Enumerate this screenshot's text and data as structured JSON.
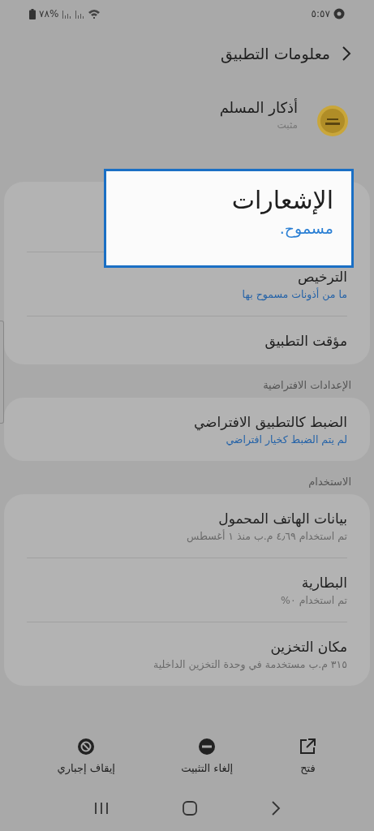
{
  "status_bar": {
    "time": "٥:٥٧",
    "battery": "%٧٨"
  },
  "header": {
    "title": "معلومات التطبيق"
  },
  "app": {
    "name": "أذكار المسلم",
    "status": "مثبت"
  },
  "highlight": {
    "title": "الإشعارات",
    "value": "مسموح."
  },
  "groups": [
    {
      "items": [
        {
          "title": "الترخيص",
          "subtitle": "ما من أذونات مسموح بها",
          "kind": "status"
        },
        {
          "title": "مؤقت التطبيق"
        }
      ]
    },
    {
      "label": "الإعدادات الافتراضية",
      "items": [
        {
          "title": "الضبط كالتطبيق الافتراضي",
          "subtitle": "لم يتم الضبط كخيار افتراضي",
          "kind": "status"
        }
      ]
    },
    {
      "label": "الاستخدام",
      "items": [
        {
          "title": "بيانات الهاتف المحمول",
          "subtitle": "تم استخدام ٤٫٦٩ م.ب منذ ١ أغسطس",
          "kind": "detail"
        },
        {
          "title": "البطارية",
          "subtitle": "تم استخدام ٠%",
          "kind": "detail"
        },
        {
          "title": "مكان التخزين",
          "subtitle": "٣١٥ م.ب مستخدمة في وحدة التخزين الداخلية",
          "kind": "detail"
        }
      ]
    }
  ],
  "actions": [
    {
      "label": "فتح",
      "kind": "open"
    },
    {
      "label": "إلغاء التثبيت",
      "kind": "uninstall"
    },
    {
      "label": "إيقاف إجباري",
      "kind": "force-stop"
    }
  ]
}
